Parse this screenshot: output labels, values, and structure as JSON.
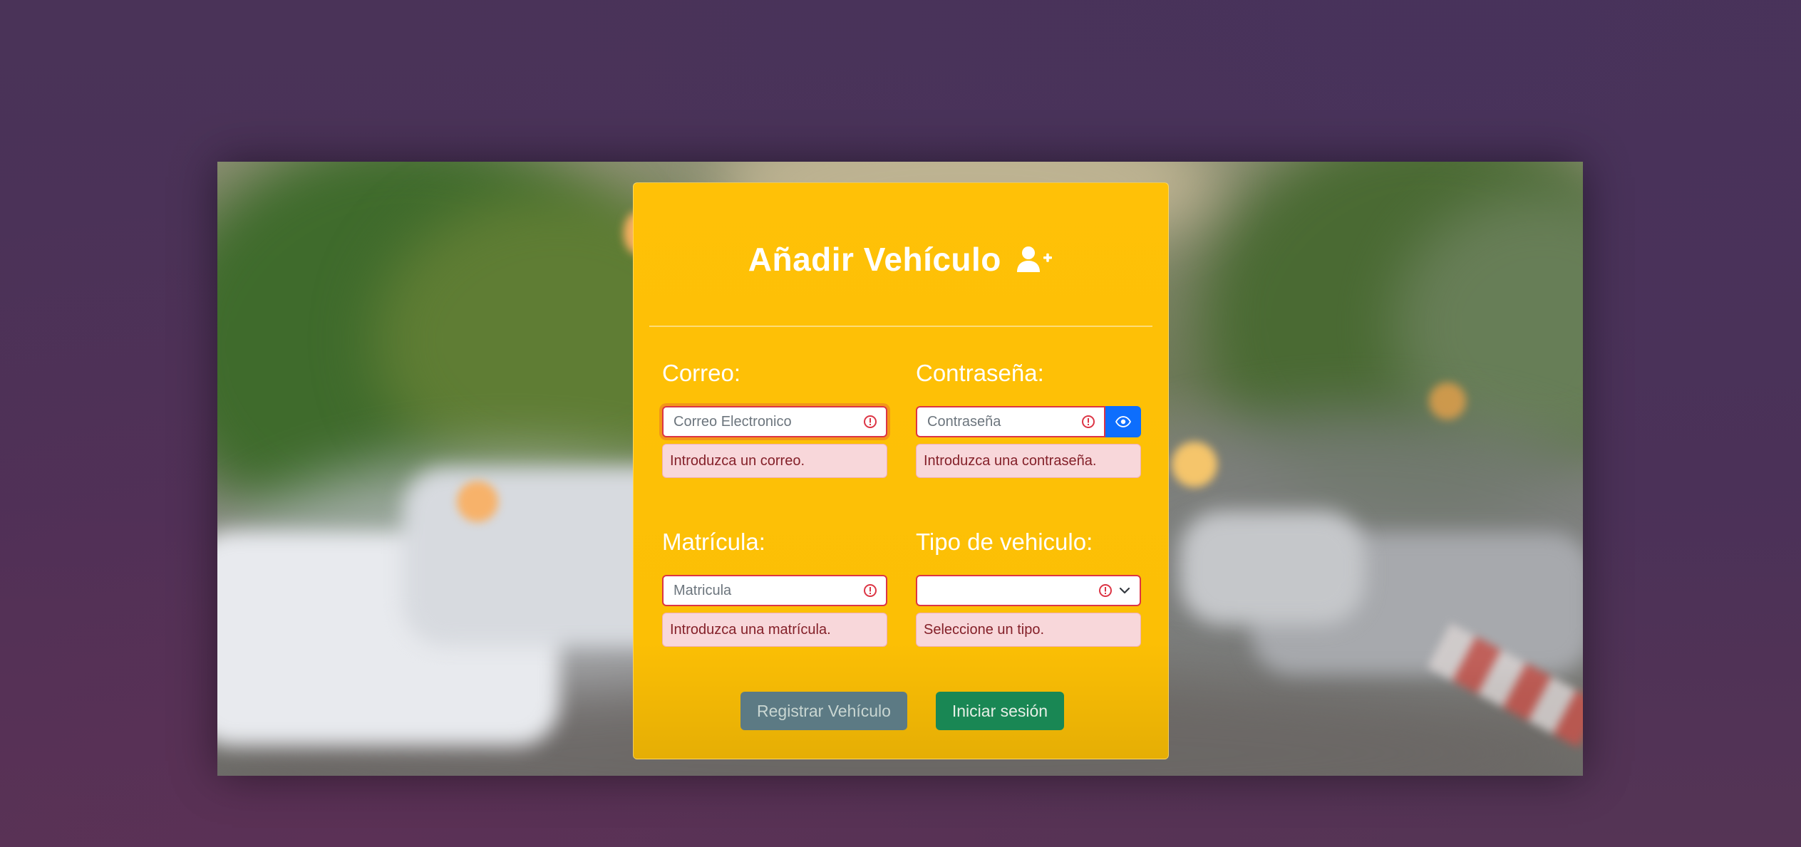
{
  "form": {
    "title": "Añadir Vehículo",
    "title_icon": "user-plus-icon",
    "correo": {
      "label": "Correo:",
      "placeholder": "Correo Electronico",
      "feedback": "Introduzca un correo."
    },
    "contrasena": {
      "label": "Contraseña:",
      "placeholder": "Contraseña",
      "toggle_icon": "eye-icon",
      "feedback": "Introduzca una contraseña."
    },
    "matricula": {
      "label": "Matrícula:",
      "placeholder": "Matricula",
      "feedback": "Introduzca una matrícula."
    },
    "tipo": {
      "label": "Tipo de vehiculo:",
      "selected": "",
      "feedback": "Seleccione un tipo."
    },
    "buttons": {
      "register": "Registrar Vehículo",
      "login": "Iniciar sesión"
    }
  },
  "colors": {
    "card": "#ffc107",
    "error": "#dc3545",
    "eye_button": "#0d6efd",
    "register_button": "#5c7a84",
    "login_button": "#198754"
  }
}
